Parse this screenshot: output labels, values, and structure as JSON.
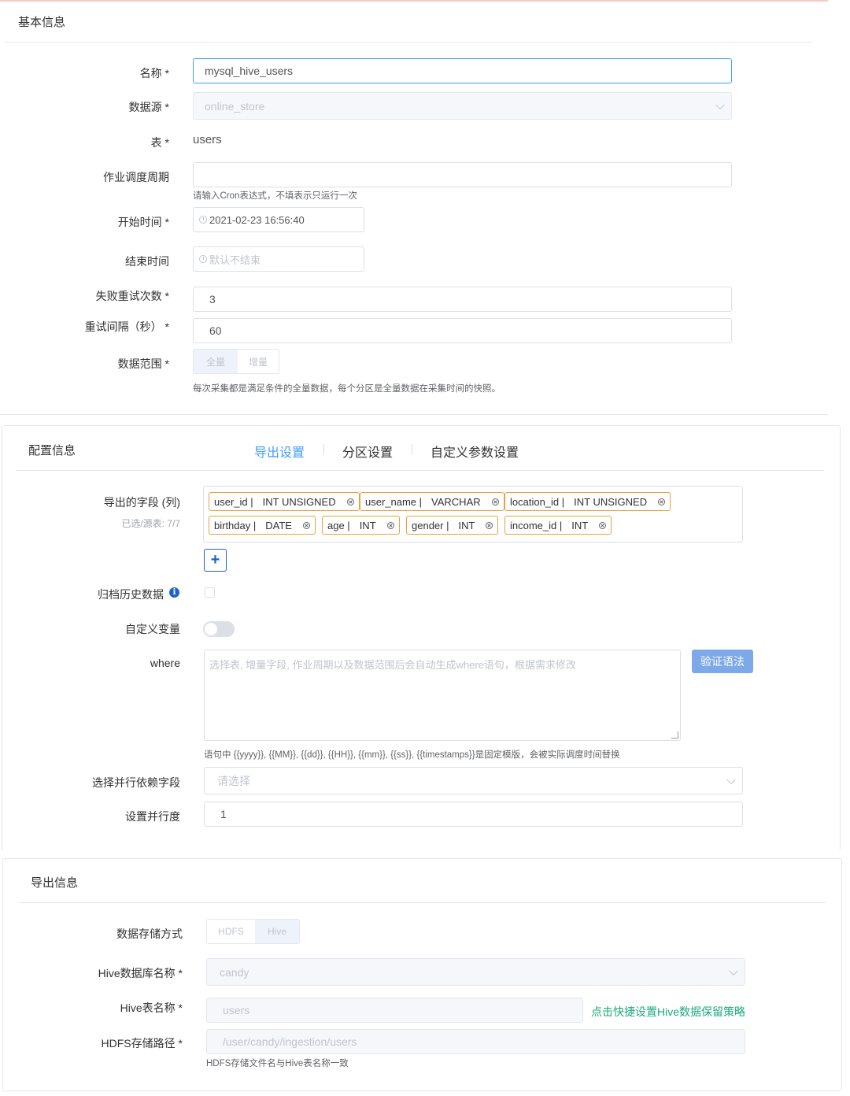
{
  "basic": {
    "title": "基本信息",
    "name_label": "名称",
    "name_value": "mysql_hive_users",
    "source_label": "数据源",
    "source_value": "online_store",
    "table_label": "表",
    "table_value": "users",
    "schedule_label": "作业调度周期",
    "schedule_value": "",
    "schedule_hint": "请输入Cron表达式，不填表示只运行一次",
    "start_label": "开始时间",
    "start_value": "2021-02-23 16:56:40",
    "end_label": "结束时间",
    "end_placeholder": "默认不结束",
    "retry_label": "失败重试次数",
    "retry_value": "3",
    "interval_label": "重试间隔（秒）",
    "interval_value": "60",
    "range_label": "数据范围",
    "range_options": [
      "全量",
      "增量"
    ],
    "range_hint": "每次采集都是满足条件的全量数据，每个分区是全量数据在采集时间的快照。"
  },
  "config": {
    "title": "配置信息",
    "tabs": [
      "导出设置",
      "分区设置",
      "自定义参数设置"
    ],
    "fields_label": "导出的字段 (列)",
    "fields_sub": "已选/源表: 7/7",
    "fields": [
      {
        "name": "user_id |",
        "type": "INT UNSIGNED"
      },
      {
        "name": "user_name |",
        "type": "VARCHAR"
      },
      {
        "name": "location_id |",
        "type": "INT UNSIGNED"
      },
      {
        "name": "birthday |",
        "type": "DATE"
      },
      {
        "name": "age |",
        "type": "INT"
      },
      {
        "name": "gender |",
        "type": "INT"
      },
      {
        "name": "income_id |",
        "type": "INT"
      }
    ],
    "add_label": "+",
    "archive_label": "归档历史数据",
    "info_glyph": "i",
    "custom_var_label": "自定义变量",
    "where_label": "where",
    "where_placeholder": "选择表, 增量字段, 作业周期以及数据范围后会自动生成where语句，根据需求修改",
    "verify_label": "验证语法",
    "where_hint": "语句中 {{yyyy}}, {{MM}}, {{dd}}, {{HH}}, {{mm}}, {{ss}}, {{timestamps}}是固定模版，会被实际调度时间替换",
    "parallel_field_label": "选择并行依赖字段",
    "parallel_field_placeholder": "请选择",
    "parallelism_label": "设置并行度",
    "parallelism_value": "1"
  },
  "export": {
    "title": "导出信息",
    "storage_label": "数据存储方式",
    "storage_options": [
      "HDFS",
      "Hive"
    ],
    "hive_db_label": "Hive数据库名称",
    "hive_db_value": "candy",
    "hive_table_label": "Hive表名称",
    "hive_table_value": "users",
    "retention_link": "点击快捷设置Hive数据保留策略",
    "hdfs_path_label": "HDFS存储路径",
    "hdfs_path_value": "/user/candy/ingestion/users",
    "hdfs_hint": "HDFS存储文件名与Hive表名称一致"
  }
}
